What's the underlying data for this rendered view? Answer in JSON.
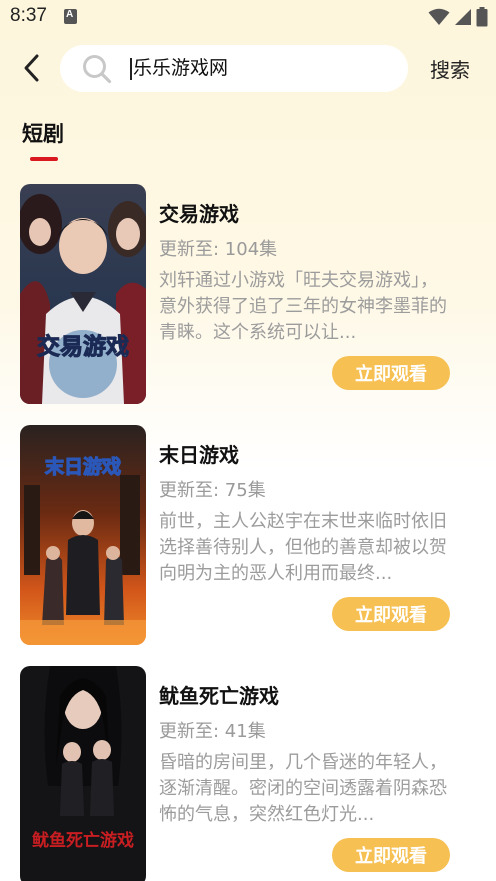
{
  "status_bar": {
    "time": "8:37",
    "icons": [
      "notification-a-icon",
      "wifi-icon",
      "cellular-signal-icon",
      "battery-icon"
    ]
  },
  "header": {
    "back_icon": "chevron-left-icon",
    "search_icon": "search-icon",
    "search_value": "乐乐游戏网",
    "search_button_label": "搜索"
  },
  "tabs": [
    {
      "label": "短剧",
      "active": true
    }
  ],
  "colors": {
    "accent": "#d9181f",
    "button": "#f6c052",
    "muted_text": "#9a9a9a"
  },
  "items": [
    {
      "title": "交易游戏",
      "episodes": "更新至: 104集",
      "description": "刘轩通过小游戏「旺夫交易游戏」，意外获得了追了三年的女神李墨菲的青睐。这个系统可以让...",
      "button_label": "立即观看",
      "cover_text": "交易游戏"
    },
    {
      "title": "末日游戏",
      "episodes": "更新至: 75集",
      "description": "前世，主人公赵宇在末世来临时依旧选择善待别人，但他的善意却被以贺向明为主的恶人利用而最终...",
      "button_label": "立即观看",
      "cover_text": "末日游戏"
    },
    {
      "title": "鱿鱼死亡游戏",
      "episodes": "更新至: 41集",
      "description": "昏暗的房间里，几个昏迷的年轻人，逐渐清醒。密闭的空间透露着阴森恐怖的气息，突然红色灯光...",
      "button_label": "立即观看",
      "cover_text": "鱿鱼死亡游戏"
    }
  ]
}
